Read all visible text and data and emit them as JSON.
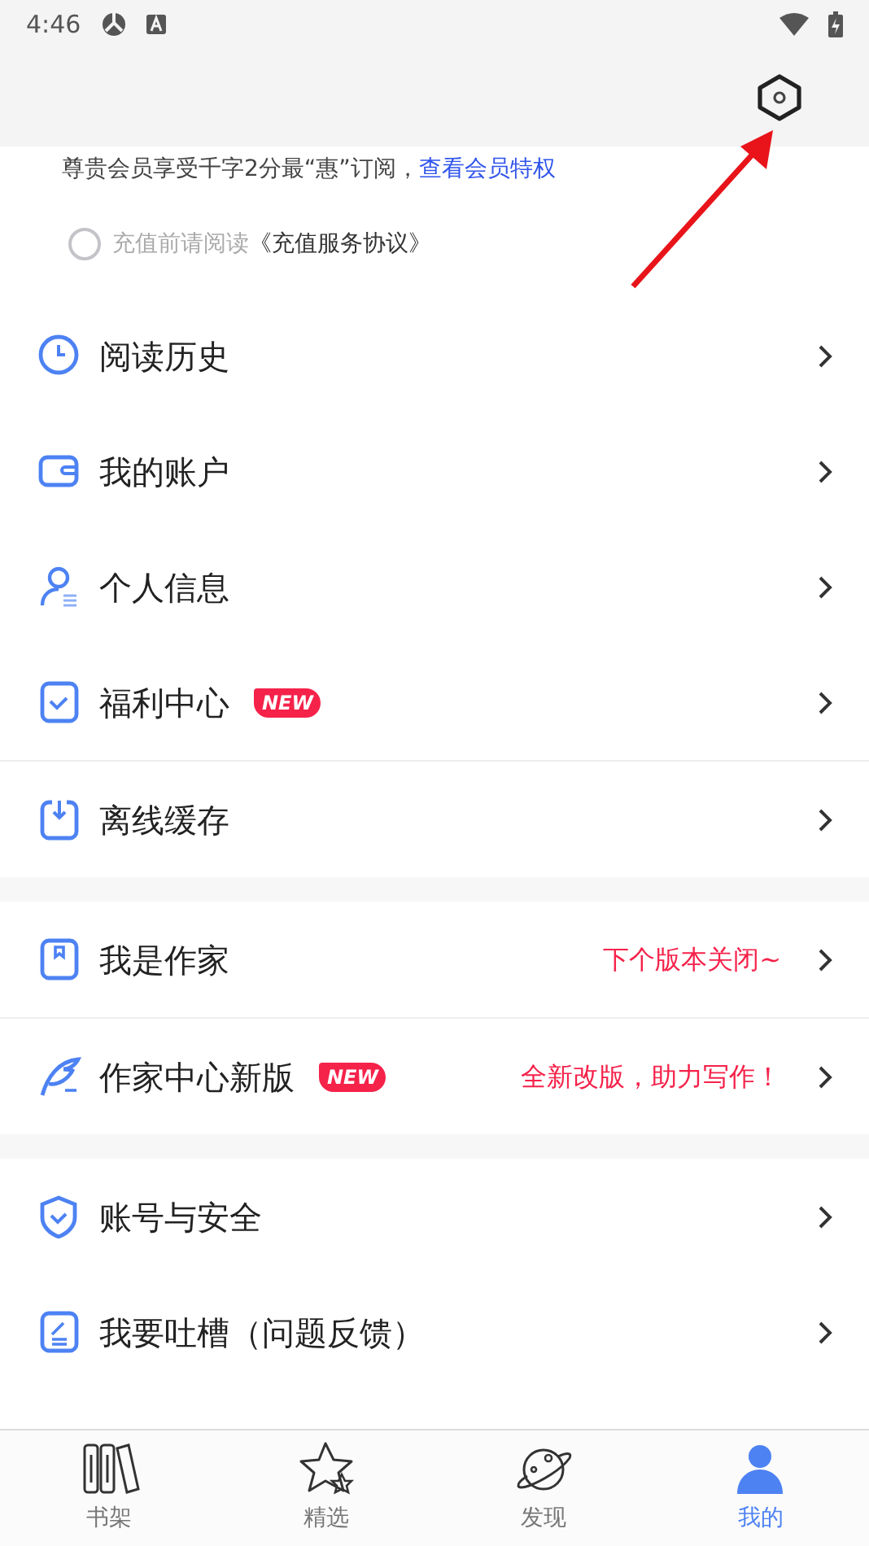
{
  "status_bar": {
    "time": "4:46"
  },
  "member_notice": {
    "text": "尊贵会员享受千字2分最“惠”订阅，",
    "link": "查看会员特权"
  },
  "agreement": {
    "checked": false,
    "prefix": "充值前请阅读",
    "link": "《充值服务协议》"
  },
  "sections": [
    {
      "items": [
        {
          "kind": "clock",
          "label": "阅读历史"
        },
        {
          "kind": "wallet",
          "label": "我的账户"
        },
        {
          "kind": "person",
          "label": "个人信息"
        },
        {
          "kind": "checkbox",
          "label": "福利中心",
          "badge": "NEW"
        }
      ]
    },
    {
      "kind": "line",
      "items": [
        {
          "kind": "download",
          "label": "离线缓存"
        }
      ]
    },
    {
      "kind": "band",
      "items": [
        {
          "kind": "book",
          "label": "我是作家",
          "note": "下个版本关闭~"
        }
      ]
    },
    {
      "kind": "line",
      "items": [
        {
          "kind": "quill",
          "label": "作家中心新版",
          "badge": "NEW",
          "note": "全新改版，助力写作！"
        }
      ]
    },
    {
      "kind": "band",
      "items": [
        {
          "kind": "shield",
          "label": "账号与安全"
        },
        {
          "kind": "note",
          "label": "我要吐槽（问题反馈）"
        }
      ]
    }
  ],
  "tabs": [
    {
      "kind": "books",
      "label": "书架",
      "selected": false
    },
    {
      "kind": "star",
      "label": "精选",
      "selected": false
    },
    {
      "kind": "planet",
      "label": "发现",
      "selected": false
    },
    {
      "kind": "user",
      "label": "我的",
      "selected": true
    }
  ]
}
